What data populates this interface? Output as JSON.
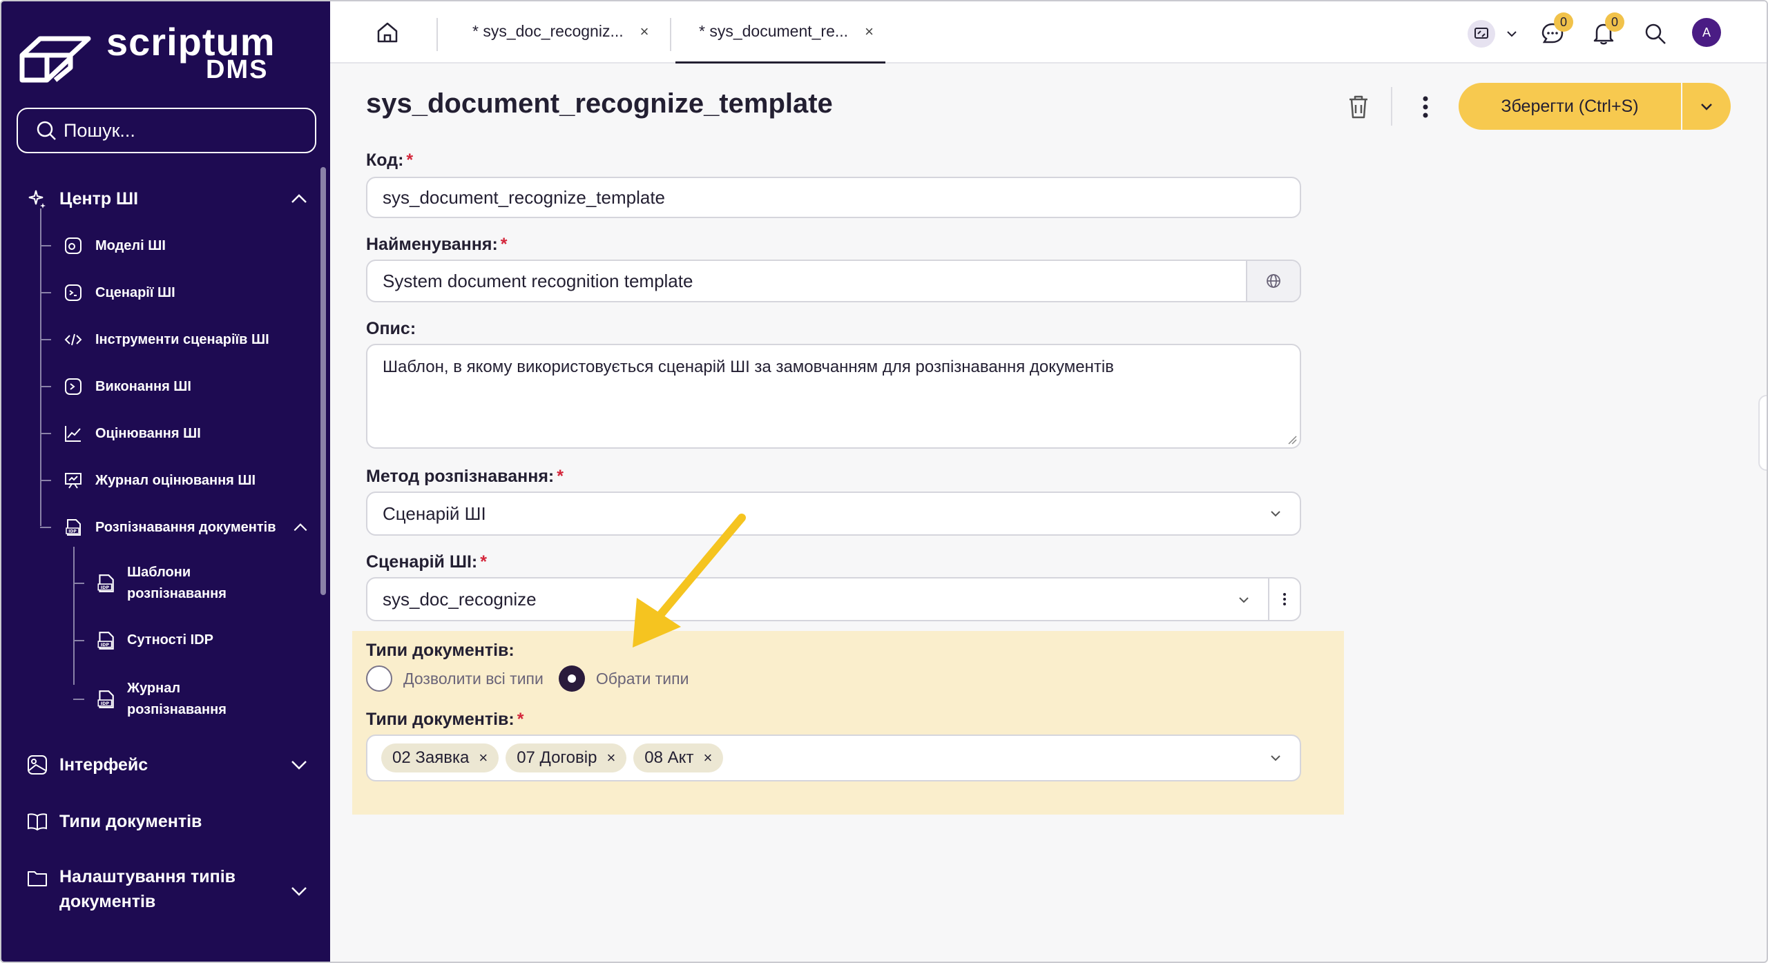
{
  "brand": {
    "name": "scriptum",
    "product": "DMS"
  },
  "search": {
    "placeholder": "Пошук..."
  },
  "sidebar": {
    "ai_center": {
      "label": "Центр ШІ",
      "items": [
        {
          "label": "Моделі ШІ",
          "icon": "model-icon"
        },
        {
          "label": "Сценарії ШІ",
          "icon": "terminal-icon"
        },
        {
          "label": "Інструменти сценаріїв ШІ",
          "icon": "code-icon"
        },
        {
          "label": "Виконання ШІ",
          "icon": "run-icon"
        },
        {
          "label": "Оцінювання ШІ",
          "icon": "chart-line-icon"
        },
        {
          "label": "Журнал оцінювання ШІ",
          "icon": "presentation-icon"
        },
        {
          "label": "Розпізнавання документів",
          "icon": "idp-icon"
        }
      ],
      "sub_items": [
        {
          "label_line1": "Шаблони",
          "label_line2": "розпізнавання"
        },
        {
          "label_line1": "Сутності IDP",
          "label_line2": ""
        },
        {
          "label_line1": "Журнал",
          "label_line2": "розпізнавання"
        }
      ]
    },
    "interface": {
      "label": "Інтерфейс"
    },
    "doc_types": {
      "label": "Типи документів"
    },
    "doc_type_settings": {
      "label_line1": "Налаштування типів",
      "label_line2": "документів"
    }
  },
  "tabs": [
    {
      "label": "* sys_doc_recogniz...",
      "close": "×"
    },
    {
      "label": "* sys_document_re...",
      "close": "×"
    }
  ],
  "topbar": {
    "chat_badge": "0",
    "notif_badge": "0",
    "avatar": "A"
  },
  "page": {
    "title": "sys_document_recognize_template",
    "save_label": "Зберегти (Ctrl+S)"
  },
  "form": {
    "code": {
      "label": "Код:",
      "required": "*",
      "value": "sys_document_recognize_template"
    },
    "name": {
      "label": "Найменування:",
      "required": "*",
      "value": "System document recognition template"
    },
    "description": {
      "label": "Опис:",
      "value": "Шаблон, в якому використовується сценарій ШІ за замовчанням для розпізнавання документів"
    },
    "method": {
      "label": "Метод розпізнавання:",
      "required": "*",
      "value": "Сценарій ШІ"
    },
    "scenario": {
      "label": "Сценарій ШІ:",
      "required": "*",
      "value": "sys_doc_recognize"
    },
    "doc_types_mode": {
      "label": "Типи документів:",
      "option_all": "Дозволити всі типи",
      "option_select": "Обрати типи",
      "selected": "Обрати типи"
    },
    "doc_types": {
      "label": "Типи документів:",
      "required": "*",
      "chips": [
        "02 Заявка",
        "07 Договір",
        "08 Акт"
      ]
    }
  },
  "colors": {
    "sidebar": "#1e0b52",
    "accent": "#f7c94f",
    "highlight": "#faeecc",
    "required": "#d4263b"
  }
}
